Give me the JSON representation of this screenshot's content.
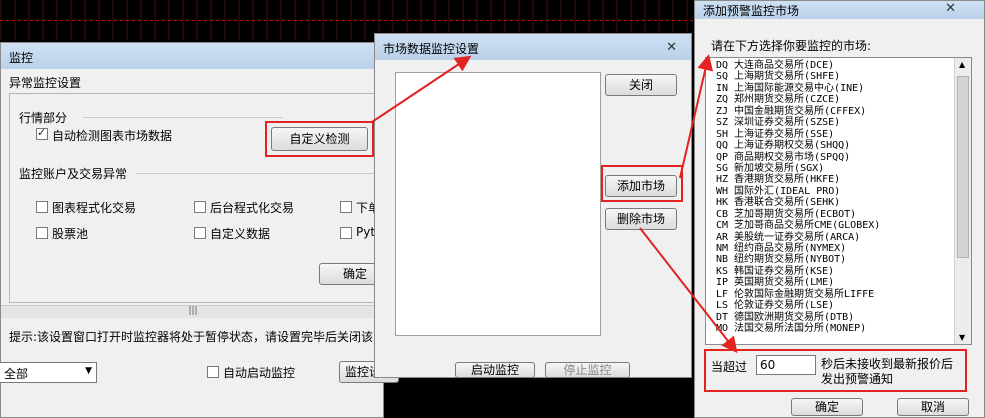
{
  "win1": {
    "title": "监控",
    "subtitle": "异常监控设置",
    "section1": "行情部分",
    "auto_detect_label": "自动检测图表市场数据",
    "custom_detect_btn": "自定义检测",
    "section2": "监控账户及交易异常",
    "opts": [
      "图表程式化交易",
      "后台程式化交易",
      "下单",
      "股票池",
      "自定义数据",
      "Pyth"
    ],
    "ok": "确定",
    "tip": "提示:该设置窗口打开时监控器将处于暂停状态，请设置完毕后关闭该",
    "select_value": "全部",
    "auto_start_label": "自动启动监控",
    "monitor_settings_btn": "监控设置",
    "start_btn": "启动监控",
    "stop_btn": "停止监控",
    "scroll_glyph": "|||"
  },
  "win2": {
    "title": "市场数据监控设置",
    "close_btn": "关闭",
    "add_btn": "添加市场",
    "del_btn": "删除市场"
  },
  "win3": {
    "title": "添加预警监控市场",
    "prompt": "请在下方选择你要监控的市场:",
    "markets": [
      "DQ 大连商品交易所(DCE)",
      "SQ 上海期货交易所(SHFE)",
      "IN 上海国际能源交易中心(INE)",
      "ZQ 郑州期货交易所(CZCE)",
      "ZJ 中国金融期货交易所(CFFEX)",
      "SZ 深圳证券交易所(SZSE)",
      "SH 上海证券交易所(SSE)",
      "QQ 上海证券期权交易(SHQQ)",
      "QP 商品期权交易市场(SPQQ)",
      "SG 新加坡交易所(SGX)",
      "HZ 香港期货交易所(HKFE)",
      "WH 国际外汇(IDEAL PRO)",
      "HK 香港联合交易所(SEHK)",
      "CB 芝加哥期货交易所(ECBOT)",
      "CM 芝加哥商品交易所CME(GLOBEX)",
      "AR 美股统一证券交易所(ARCA)",
      "NM 纽约商品交易所(NYMEX)",
      "NB 纽约期货交易所(NYBOT)",
      "KS 韩国证券交易所(KSE)",
      "IP 英国期货交易所(LME)",
      "LF 伦敦国际金融期货交易所LIFFE",
      "LS 伦敦证券交易所(LSE)",
      "DT 德国欧洲期货交易所(DTB)",
      "MO 法国交易所法国分所(MONEP)"
    ],
    "when_exceed": "当超过",
    "seconds_value": "60",
    "suffix_text": "秒后未接收到最新报价后发出预警通知",
    "ok": "确定",
    "cancel": "取消",
    "scroll_up": "▲",
    "scroll_down": "▼"
  },
  "close_glyph": "✕",
  "select_arrow": "▼"
}
